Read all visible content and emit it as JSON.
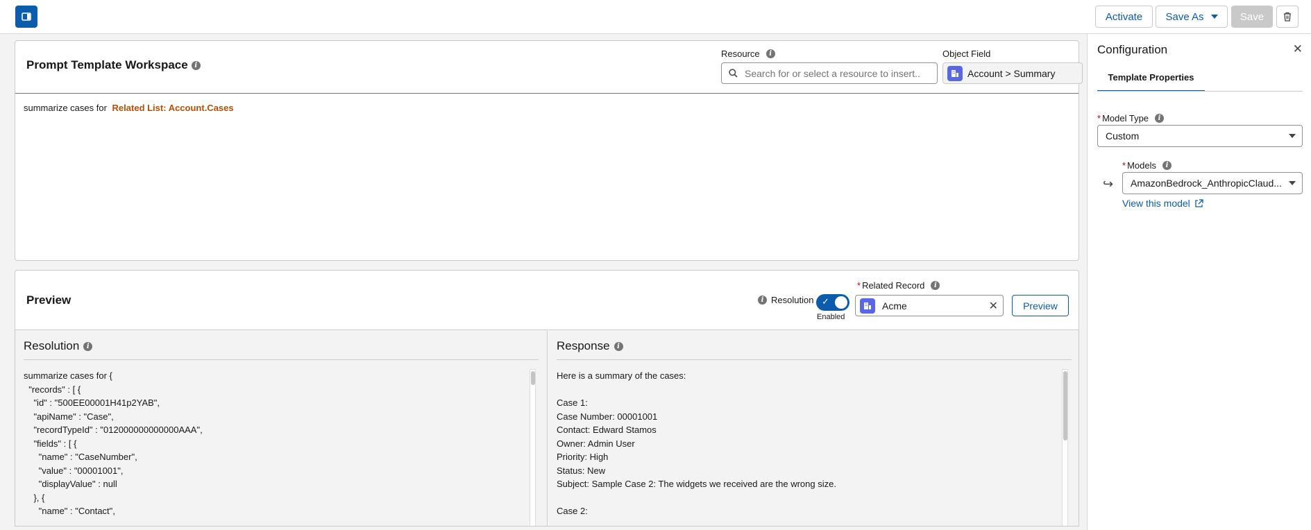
{
  "toolbar": {
    "activate_label": "Activate",
    "save_as_label": "Save As",
    "save_label": "Save"
  },
  "workspace": {
    "title": "Prompt Template Workspace",
    "resource_label": "Resource",
    "resource_placeholder": "Search for or select a resource to insert..",
    "object_field_label": "Object Field",
    "object_field_value": "Account > Summary",
    "editor_text": "summarize cases for",
    "merge_field": "Related List: Account.Cases"
  },
  "preview": {
    "title": "Preview",
    "resolution_toggle_label": "Resolution",
    "toggle_state": "Enabled",
    "related_record_label": "Related Record",
    "related_record_value": "Acme",
    "preview_button": "Preview",
    "resolution_header": "Resolution",
    "response_header": "Response",
    "resolution_lines": [
      "summarize cases for {",
      "  \"records\" : [ {",
      "    \"id\" : \"500EE00001H41p2YAB\",",
      "    \"apiName\" : \"Case\",",
      "    \"recordTypeId\" : \"012000000000000AAA\",",
      "    \"fields\" : [ {",
      "      \"name\" : \"CaseNumber\",",
      "      \"value\" : \"00001001\",",
      "      \"displayValue\" : null",
      "    }, {",
      "      \"name\" : \"Contact\","
    ],
    "response_lines": [
      "Here is a summary of the cases:",
      "",
      "Case 1:",
      "Case Number: 00001001",
      "Contact: Edward Stamos",
      "Owner: Admin User",
      "Priority: High",
      "Status: New",
      "Subject: Sample Case 2: The widgets we received are the wrong size.",
      "",
      "Case 2:"
    ]
  },
  "configuration": {
    "title": "Configuration",
    "tab": "Template Properties",
    "model_type_label": "Model Type",
    "model_type_value": "Custom",
    "models_label": "Models",
    "models_value": "AmazonBedrock_AnthropicClaud...",
    "view_model_link": "View this model"
  },
  "colors": {
    "brand": "#0b5cab",
    "merge_field": "#ba4d00",
    "object_icon": "#5867e8",
    "required": "#ba0517"
  },
  "icons": [
    "panel-toggle-icon",
    "info-icon",
    "search-icon",
    "object-icon",
    "chevron-down-icon",
    "trash-icon",
    "close-icon",
    "check-icon",
    "return-arrow-icon",
    "external-link-icon"
  ]
}
